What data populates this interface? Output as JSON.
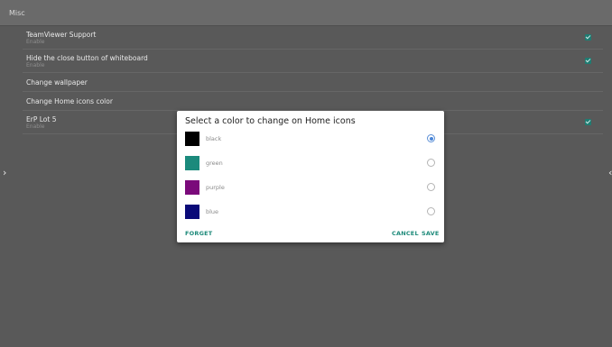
{
  "header": {
    "title": "Misc"
  },
  "settings": {
    "teamviewer": {
      "title": "TeamViewer Support",
      "sub": "Enable"
    },
    "hide_close": {
      "title": "Hide the close button of whiteboard",
      "sub": "Enable"
    },
    "wallpaper": {
      "title": "Change wallpaper"
    },
    "home_icons": {
      "title": "Change Home icons color"
    },
    "erp": {
      "title": "ErP Lot 5",
      "sub": "Enable"
    }
  },
  "nav": {
    "left_icon": "chevron-right-icon",
    "left_glyph": "›",
    "right_icon": "chevron-left-icon",
    "right_glyph": "‹"
  },
  "dialog": {
    "title": "Select a color to change on Home icons",
    "options": [
      {
        "label": "black",
        "color": "#000000",
        "selected": true
      },
      {
        "label": "green",
        "color": "#1b8a7c",
        "selected": false
      },
      {
        "label": "purple",
        "color": "#7a0a7a",
        "selected": false
      },
      {
        "label": "blue",
        "color": "#0a0a78",
        "selected": false
      }
    ],
    "buttons": {
      "forget": "FORGET",
      "cancel": "CANCEL",
      "save": "SAVE"
    }
  },
  "colors": {
    "accent": "#1e8a7a",
    "radio_selected": "#4a86d8"
  }
}
